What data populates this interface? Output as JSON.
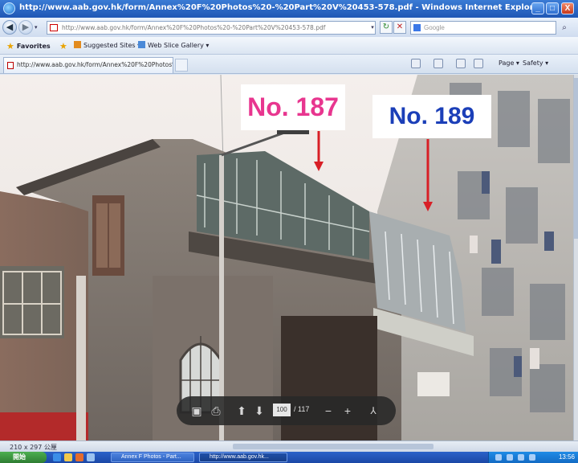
{
  "window": {
    "title": "http://www.aab.gov.hk/form/Annex%20F%20Photos%20-%20Part%20V%20453-578.pdf - Windows Internet Explorer",
    "controls": [
      "_",
      "□",
      "X"
    ]
  },
  "nav": {
    "address": "http://www.aab.gov.hk/form/Annex%20F%20Photos%20-%20Part%20V%20453-578.pdf",
    "search_placeholder": "Google"
  },
  "favorites_bar": {
    "favorites_label": "Favorites",
    "items": [
      "Suggested Sites ▾",
      "Web Slice Gallery ▾"
    ]
  },
  "tabs": [
    {
      "label": "http://www.aab.gov.hk/form/Annex%20F%20Photos%2..."
    }
  ],
  "command_bar": {
    "page_label": "Page ▾",
    "safety_label": "Safety ▾"
  },
  "annotations": [
    {
      "text": "No. 187",
      "color": "#e8368f"
    },
    {
      "text": "No. 189",
      "color": "#1b3fb8"
    }
  ],
  "pdf_toolbar": {
    "current_page": "100",
    "total_pages": "/ 117",
    "buttons": [
      "save-icon",
      "print-icon",
      "page-up-icon",
      "page-down-icon",
      "zoom-out-icon",
      "zoom-in-icon",
      "acrobat-icon"
    ]
  },
  "status_bar": {
    "dimensions": "210 x 297 公厘"
  },
  "taskbar": {
    "start_label": "開始",
    "tasks": [
      "Annex F Photos - Part...",
      "http://www.aab.gov.hk..."
    ],
    "clock": "13:56"
  },
  "colors": {
    "titlebar": "#2a68c8",
    "label_187": "#e8368f",
    "label_189": "#1b3fb8",
    "arrow": "#d81f26"
  }
}
